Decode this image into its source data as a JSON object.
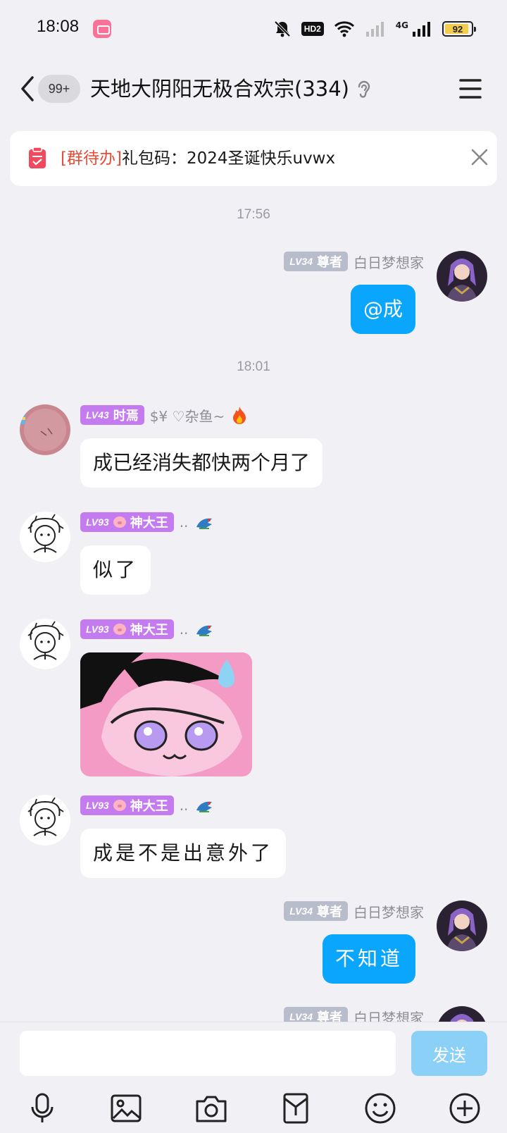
{
  "status_bar": {
    "time": "18:08",
    "hd_label": "HD2",
    "network": "4G",
    "battery": "92",
    "battery_level": 0.92
  },
  "header": {
    "unread_count": "99+",
    "title": "天地大阴阳无极合欢宗(334)"
  },
  "notice": {
    "tag": "[群待办]",
    "text": "礼包码：2024圣诞快乐uvwx"
  },
  "messages": [
    {
      "type": "time",
      "text": "17:56"
    },
    {
      "type": "msg",
      "side": "right",
      "level": "LV34",
      "title": "尊者",
      "nick": "白日梦想家",
      "text": "@成"
    },
    {
      "type": "time",
      "text": "18:01"
    },
    {
      "type": "msg",
      "side": "left",
      "level": "LV43",
      "title": "时焉",
      "nick": "$¥   ♡杂鱼~",
      "text": "成已经消失都快两个月了"
    },
    {
      "type": "msg",
      "side": "left",
      "level": "LV93",
      "title": "神大王",
      "nick": "..",
      "text": "似了"
    },
    {
      "type": "sticker",
      "side": "left",
      "level": "LV93",
      "title": "神大王",
      "nick": ".."
    },
    {
      "type": "msg",
      "side": "left",
      "level": "LV93",
      "title": "神大王",
      "nick": "..",
      "text": "成是不是出意外了"
    },
    {
      "type": "msg",
      "side": "right",
      "level": "LV34",
      "title": "尊者",
      "nick": "白日梦想家",
      "text": "不知道"
    },
    {
      "type": "msg",
      "side": "right",
      "level": "LV34",
      "title": "尊者",
      "nick": "白日梦想家"
    }
  ],
  "input": {
    "placeholder": "",
    "send_label": "发送"
  },
  "toolbar": {
    "icons": [
      "microphone-icon",
      "image-icon",
      "camera-icon",
      "red-packet-icon",
      "emoji-icon",
      "plus-icon"
    ]
  },
  "colors": {
    "self_bubble": "#0aa6fd",
    "accent_red": "#e64e3a",
    "badge_purple": "#c47bf0",
    "badge_gray": "#b8bdcc",
    "send_disabled": "#8ad0f7"
  }
}
